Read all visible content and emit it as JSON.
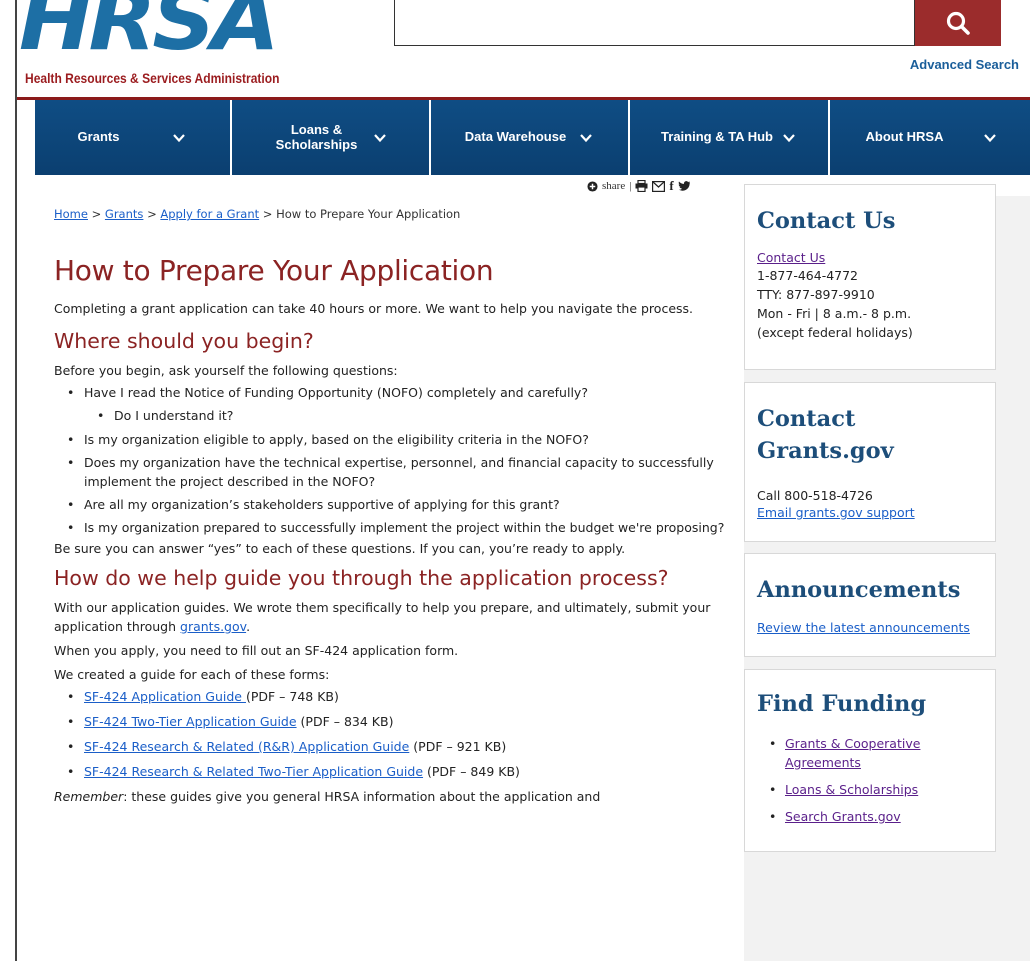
{
  "header": {
    "logo_text": "HRSA",
    "logo_subtitle": "Health Resources & Services Administration",
    "search_placeholder": "",
    "search_icon": "search-icon",
    "advanced_search_label": "Advanced Search"
  },
  "nav": {
    "items": [
      {
        "label": "Grants"
      },
      {
        "label": "Loans & Scholarships"
      },
      {
        "label": "Data Warehouse"
      },
      {
        "label": "Training & TA Hub"
      },
      {
        "label": "About HRSA"
      }
    ]
  },
  "share": {
    "share_label": "share",
    "separator": "|"
  },
  "breadcrumb": {
    "home": "Home",
    "grants": "Grants",
    "apply": "Apply for a Grant",
    "current": "How to Prepare Your Application",
    "sep": ">"
  },
  "main": {
    "title": "How to Prepare Your Application",
    "intro": "Completing a grant application can take 40 hours or more. We want to help you navigate the process.",
    "section1_heading": "Where should you begin?",
    "section1_intro": "Before you begin, ask yourself the following questions:",
    "questions": [
      "Have I read the Notice of Funding Opportunity (NOFO) completely and carefully?",
      "Do I understand it?",
      "Is my organization eligible to apply, based on the eligibility criteria in the NOFO?",
      "Does my organization have the technical expertise, personnel, and financial capacity to successfully implement the project described in the NOFO?",
      "Are all my organization’s stakeholders supportive of applying for this grant?",
      "Is my organization prepared to successfully implement the project within the budget we're proposing?"
    ],
    "section1_outro": "Be sure you can answer “yes” to each of these questions. If you can, you’re ready to apply.",
    "section2_heading": "How do we help guide you through the application process?",
    "section2_p1_a": "With our application guides. We wrote them specifically to help you prepare, and ultimately, submit your application through ",
    "section2_p1_link": "grants.gov",
    "section2_p1_b": ".",
    "section2_p2": "When you apply, you need to fill out an SF-424 application form.",
    "section2_p3": "We created a guide for each of these forms:",
    "guides": [
      {
        "link": "SF-424 Application Guide ",
        "suffix": "(PDF – 748 KB)"
      },
      {
        "link": "SF-424 Two-Tier Application Guide",
        "suffix": " (PDF – 834 KB)"
      },
      {
        "link": "SF-424 Research & Related (R&R) Application Guide",
        "suffix": " (PDF – 921 KB)"
      },
      {
        "link": "SF-424 Research & Related Two-Tier Application Guide",
        "suffix": " (PDF – 849 KB)"
      }
    ],
    "remember_label": "Remember",
    "remember_text": ": these guides give you general HRSA information about the application and"
  },
  "sidebar": {
    "contact": {
      "heading": "Contact Us",
      "link": "Contact Us",
      "phone": "1-877-464-4772",
      "tty": "TTY: 877-897-9910",
      "hours": "Mon - Fri | 8 a.m.- 8 p.m.",
      "note": "(except federal holidays)"
    },
    "grantsgov": {
      "heading": "Contact Grants.gov",
      "call": "Call 800-518-4726",
      "email_link": "Email grants.gov support"
    },
    "announcements": {
      "heading": "Announcements",
      "link": "Review the latest announcements"
    },
    "funding": {
      "heading": "Find Funding",
      "items": [
        "Grants & Cooperative Agreements",
        "Loans & Scholarships",
        "Search Grants.gov"
      ]
    }
  },
  "colors": {
    "brand_blue": "#1d6fa5",
    "brand_red": "#9b1c1f",
    "nav_blue": "#0f4d84",
    "heading_red": "#8b2323",
    "sidebar_heading": "#1d4e7a"
  }
}
